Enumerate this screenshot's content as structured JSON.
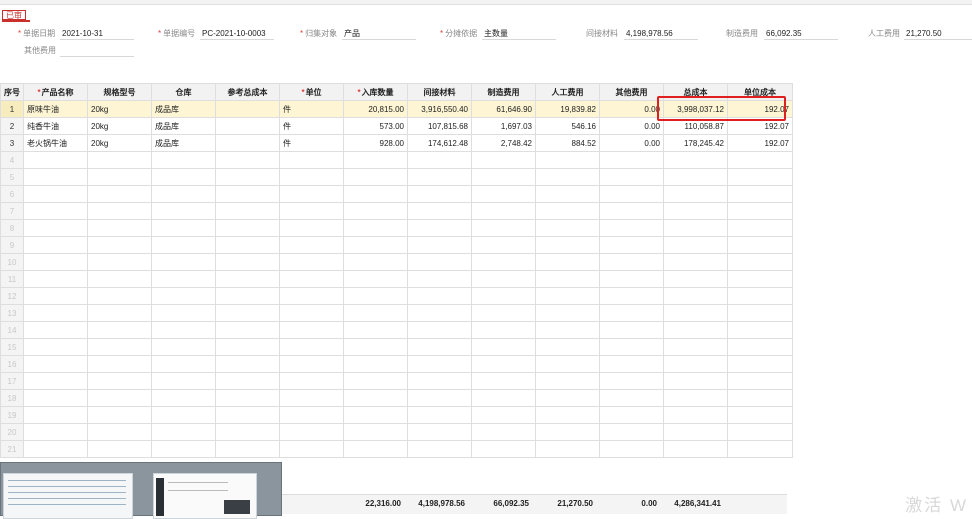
{
  "status_badge": "已审",
  "header_fields": [
    {
      "label": "单据日期",
      "required": true,
      "value": "2021-10-31"
    },
    {
      "label": "单据编号",
      "required": true,
      "value": "PC-2021-10-0003"
    },
    {
      "label": "归集对象",
      "required": true,
      "value": "产品"
    },
    {
      "label": "分摊依据",
      "required": true,
      "value": "主数量"
    },
    {
      "label": "间接材料",
      "required": false,
      "value": "4,198,978.56"
    },
    {
      "label": "制造费用",
      "required": false,
      "value": "66,092.35"
    },
    {
      "label": "人工费用",
      "required": false,
      "value": "21,270.50"
    },
    {
      "label": "其他费用",
      "required": false,
      "value": ""
    }
  ],
  "table": {
    "columns": [
      {
        "label": "序号",
        "required": false
      },
      {
        "label": "产品名称",
        "required": true
      },
      {
        "label": "规格型号",
        "required": false
      },
      {
        "label": "仓库",
        "required": false
      },
      {
        "label": "参考总成本",
        "required": false
      },
      {
        "label": "单位",
        "required": true
      },
      {
        "label": "入库数量",
        "required": true
      },
      {
        "label": "间接材料",
        "required": false
      },
      {
        "label": "制造费用",
        "required": false
      },
      {
        "label": "人工费用",
        "required": false
      },
      {
        "label": "其他费用",
        "required": false
      },
      {
        "label": "总成本",
        "required": false
      },
      {
        "label": "单位成本",
        "required": false
      }
    ],
    "rows": [
      [
        "1",
        "原味牛油",
        "20kg",
        "成品库",
        "",
        "件",
        "20,815.00",
        "3,916,550.40",
        "61,646.90",
        "19,839.82",
        "0.00",
        "3,998,037.12",
        "192.07"
      ],
      [
        "2",
        "纯香牛油",
        "20kg",
        "成品库",
        "",
        "件",
        "573.00",
        "107,815.68",
        "1,697.03",
        "546.16",
        "0.00",
        "110,058.87",
        "192.07"
      ],
      [
        "3",
        "老火锅牛油",
        "20kg",
        "成品库",
        "",
        "件",
        "928.00",
        "174,612.48",
        "2,748.42",
        "884.52",
        "0.00",
        "178,245.42",
        "192.07"
      ]
    ],
    "empty_rows": [
      "4",
      "5",
      "6",
      "7",
      "8",
      "9",
      "10",
      "11",
      "12",
      "13",
      "14",
      "15",
      "16",
      "17",
      "18",
      "19",
      "20",
      "21"
    ]
  },
  "totals": {
    "qty": "22,316.00",
    "indirect": "4,198,978.56",
    "manufacturing": "66,092.35",
    "labor": "21,270.50",
    "other": "0.00",
    "total": "4,286,341.41"
  },
  "watermark": "激活 W",
  "colors": {
    "highlight": "#e02020",
    "required": "#e04040",
    "selected_row": "#fdf5d3"
  }
}
